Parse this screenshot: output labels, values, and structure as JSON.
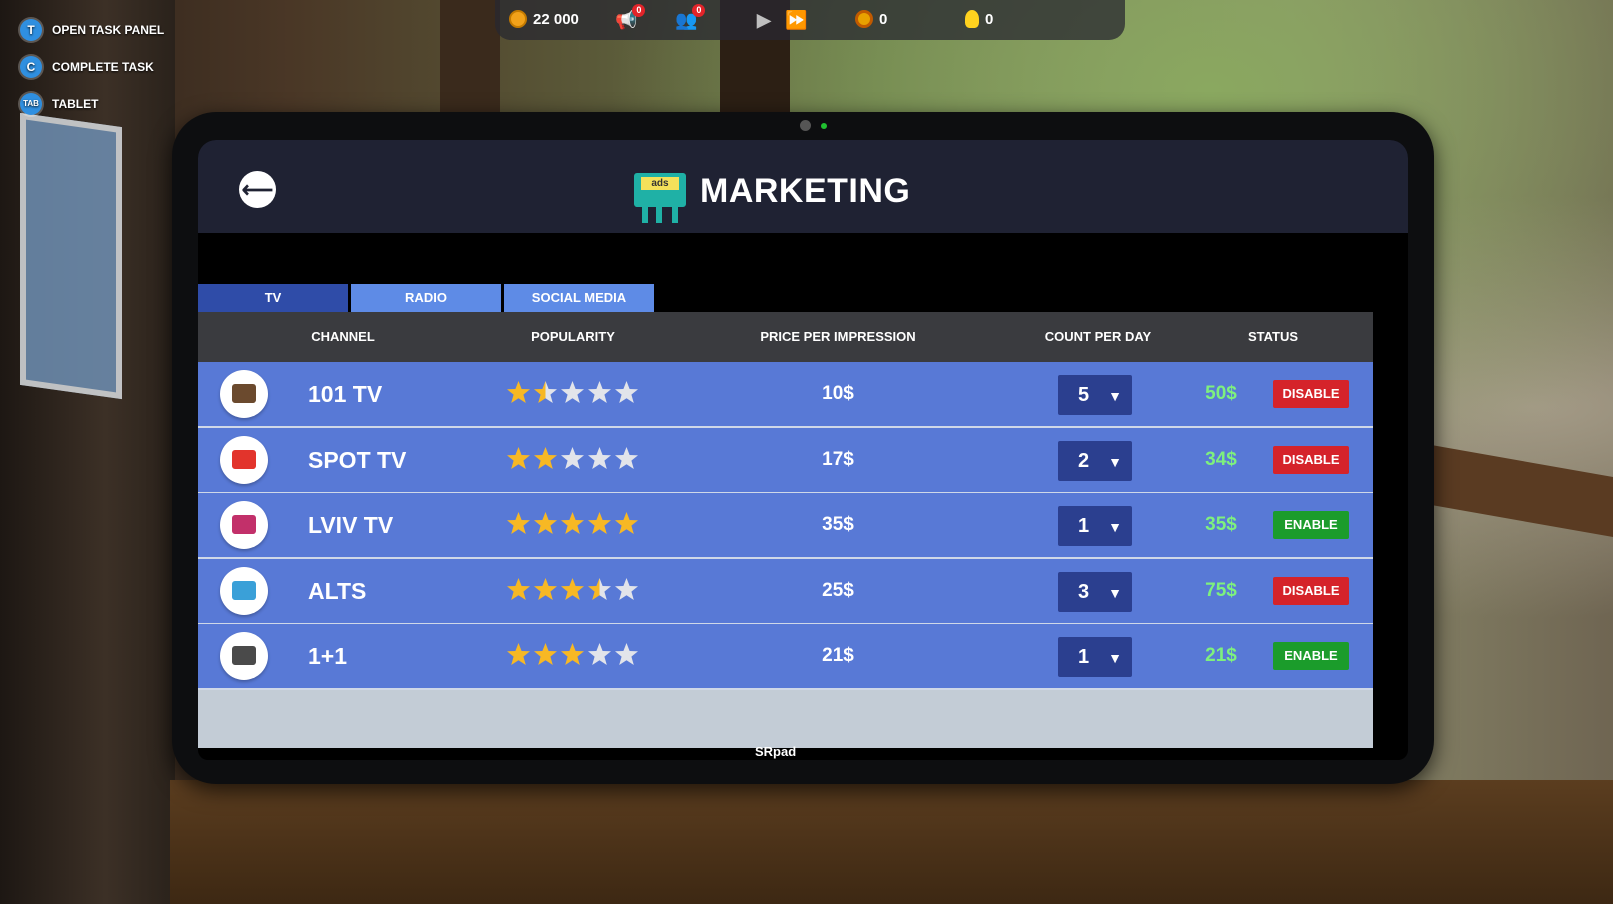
{
  "hud": {
    "money": "22 000",
    "megaphone_badge": "0",
    "staff_badge": "0",
    "medals": "0",
    "ideas": "0"
  },
  "hotkeys": [
    {
      "key": "T",
      "label": "OPEN TASK PANEL"
    },
    {
      "key": "C",
      "label": "COMPLETE TASK"
    },
    {
      "key": "TAB",
      "label": "TABLET"
    }
  ],
  "screen": {
    "title": "MARKETING",
    "ads_tag": "ads",
    "tabs": [
      "TV",
      "RADIO",
      "SOCIAL MEDIA"
    ],
    "active_tab": "TV",
    "columns": [
      "CHANNEL",
      "POPULARITY",
      "PRICE PER IMPRESSION",
      "COUNT PER DAY",
      "STATUS"
    ],
    "rows": [
      {
        "channel": "101 TV",
        "rating": 1.5,
        "price": "10$",
        "count": "5",
        "total": "50$",
        "status": "DISABLE",
        "logo_color": "#6b4a2e"
      },
      {
        "channel": "SPOT TV",
        "rating": 2,
        "price": "17$",
        "count": "2",
        "total": "34$",
        "status": "DISABLE",
        "logo_color": "#e2342c"
      },
      {
        "channel": "LVIV TV",
        "rating": 5,
        "price": "35$",
        "count": "1",
        "total": "35$",
        "status": "ENABLE",
        "logo_color": "#c2306a"
      },
      {
        "channel": "ALTS",
        "rating": 3.5,
        "price": "25$",
        "count": "3",
        "total": "75$",
        "status": "DISABLE",
        "logo_color": "#3aa0d8"
      },
      {
        "channel": "1+1",
        "rating": 3,
        "price": "21$",
        "count": "1",
        "total": "21$",
        "status": "ENABLE",
        "logo_color": "#4a4a4a"
      }
    ],
    "brand": "SRpad"
  },
  "colors": {
    "star_on": "#f7b824",
    "star_off": "#e2e4ea",
    "total_green": "#7ef07e",
    "disable_red": "#d5232a",
    "enable_green": "#1b9c2b"
  }
}
